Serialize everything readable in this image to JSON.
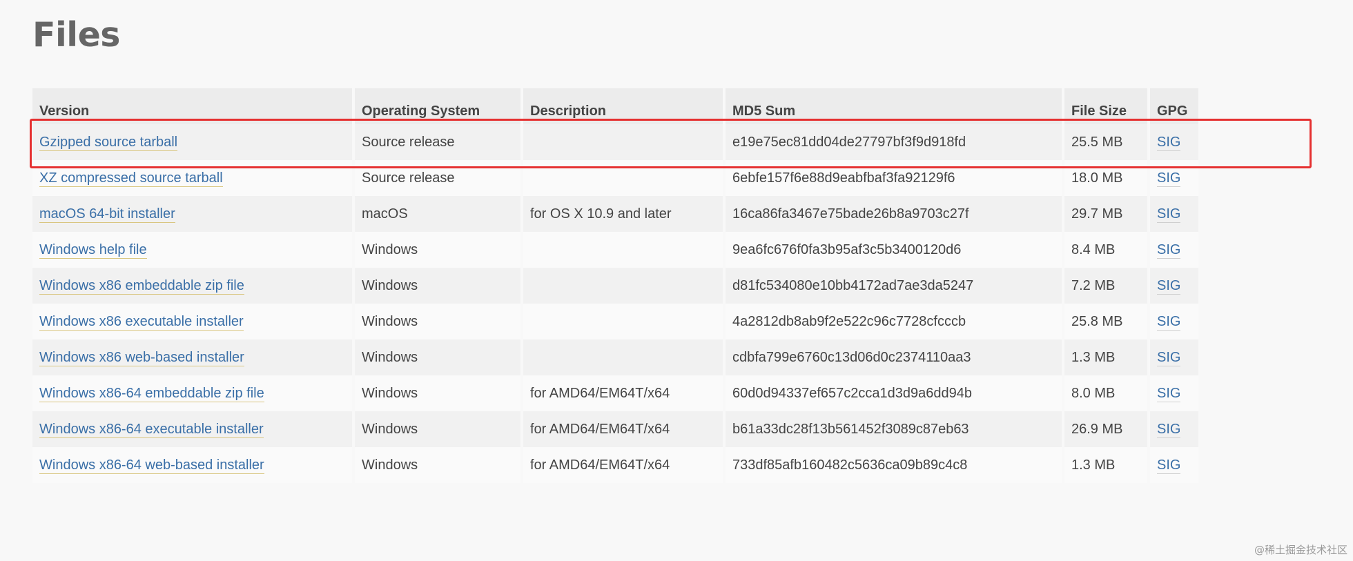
{
  "page": {
    "title": "Files"
  },
  "table": {
    "headers": {
      "version": "Version",
      "os": "Operating System",
      "description": "Description",
      "md5": "MD5 Sum",
      "size": "File Size",
      "gpg": "GPG"
    },
    "rows": [
      {
        "version": "Gzipped source tarball",
        "os": "Source release",
        "description": "",
        "md5": "e19e75ec81dd04de27797bf3f9d918fd",
        "size": "25.5 MB",
        "gpg": "SIG"
      },
      {
        "version": "XZ compressed source tarball",
        "os": "Source release",
        "description": "",
        "md5": "6ebfe157f6e88d9eabfbaf3fa92129f6",
        "size": "18.0 MB",
        "gpg": "SIG"
      },
      {
        "version": "macOS 64-bit installer",
        "os": "macOS",
        "description": "for OS X 10.9 and later",
        "md5": "16ca86fa3467e75bade26b8a9703c27f",
        "size": "29.7 MB",
        "gpg": "SIG"
      },
      {
        "version": "Windows help file",
        "os": "Windows",
        "description": "",
        "md5": "9ea6fc676f0fa3b95af3c5b3400120d6",
        "size": "8.4 MB",
        "gpg": "SIG"
      },
      {
        "version": "Windows x86 embeddable zip file",
        "os": "Windows",
        "description": "",
        "md5": "d81fc534080e10bb4172ad7ae3da5247",
        "size": "7.2 MB",
        "gpg": "SIG"
      },
      {
        "version": "Windows x86 executable installer",
        "os": "Windows",
        "description": "",
        "md5": "4a2812db8ab9f2e522c96c7728cfcccb",
        "size": "25.8 MB",
        "gpg": "SIG"
      },
      {
        "version": "Windows x86 web-based installer",
        "os": "Windows",
        "description": "",
        "md5": "cdbfa799e6760c13d06d0c2374110aa3",
        "size": "1.3 MB",
        "gpg": "SIG"
      },
      {
        "version": "Windows x86-64 embeddable zip file",
        "os": "Windows",
        "description": "for AMD64/EM64T/x64",
        "md5": "60d0d94337ef657c2cca1d3d9a6dd94b",
        "size": "8.0 MB",
        "gpg": "SIG"
      },
      {
        "version": "Windows x86-64 executable installer",
        "os": "Windows",
        "description": "for AMD64/EM64T/x64",
        "md5": "b61a33dc28f13b561452f3089c87eb63",
        "size": "26.9 MB",
        "gpg": "SIG"
      },
      {
        "version": "Windows x86-64 web-based installer",
        "os": "Windows",
        "description": "for AMD64/EM64T/x64",
        "md5": "733df85afb160482c5636ca09b89c4c8",
        "size": "1.3 MB",
        "gpg": "SIG"
      }
    ]
  },
  "highlight": {
    "row_index": 0,
    "color": "#e53030"
  },
  "colors": {
    "link": "#3a6fa7",
    "title": "#666666",
    "header_bg": "#ececec"
  },
  "watermark": "@稀土掘金技术社区"
}
